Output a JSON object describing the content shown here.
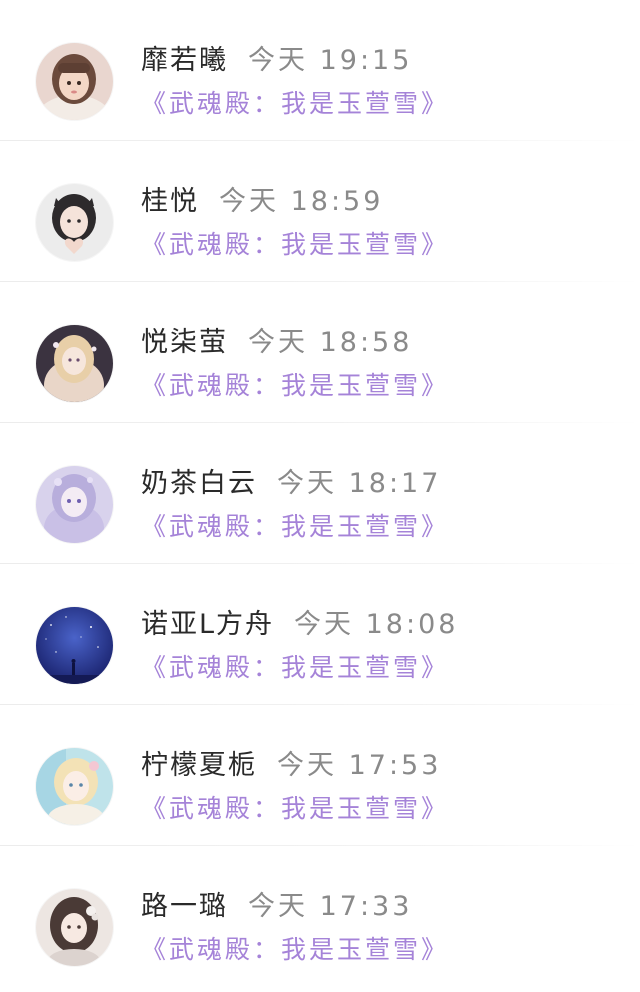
{
  "messages": [
    {
      "name": "靡若曦",
      "time": "今天 19:15",
      "text": "《武魂殿：我是玉萱雪》",
      "avatar": "girl-photo-avatar"
    },
    {
      "name": "桂悦",
      "time": "今天 18:59",
      "text": "《武魂殿：我是玉萱雪》",
      "avatar": "girl-heart-hands-avatar"
    },
    {
      "name": "悦柒萤",
      "time": "今天 18:58",
      "text": "《武魂殿：我是玉萱雪》",
      "avatar": "anime-princess-avatar"
    },
    {
      "name": "奶茶白云",
      "time": "今天 18:17",
      "text": "《武魂殿：我是玉萱雪》",
      "avatar": "anime-lavender-girl-avatar"
    },
    {
      "name": "诺亚L方舟",
      "time": "今天 18:08",
      "text": "《武魂殿：我是玉萱雪》",
      "avatar": "starry-sky-avatar"
    },
    {
      "name": "柠檬夏栀",
      "time": "今天 17:53",
      "text": "《武魂殿：我是玉萱雪》",
      "avatar": "anime-pastel-girl-avatar"
    },
    {
      "name": "路一璐",
      "time": "今天 17:33",
      "text": "《武魂殿：我是玉萱雪》",
      "avatar": "anime-flower-girl-avatar"
    }
  ],
  "colors": {
    "name": "#2a2a2a",
    "time": "#8a8a8a",
    "message": "#a583d8",
    "divider": "#ececec"
  }
}
